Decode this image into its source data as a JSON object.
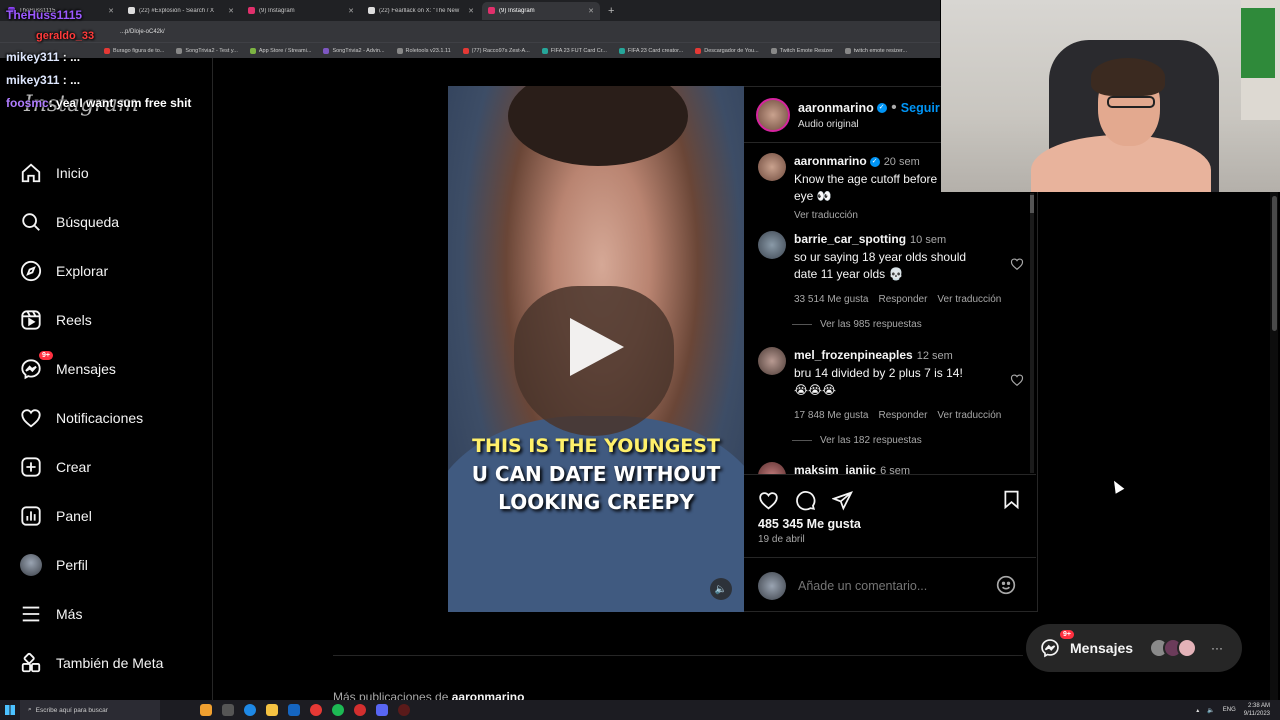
{
  "browser": {
    "tabs": [
      {
        "label": "TheHuss1115",
        "color": "#9146ff",
        "active": false
      },
      {
        "label": "(22) #Explosión - Search / X",
        "color": "#ffffff",
        "active": false
      },
      {
        "label": "(9) Instagram",
        "color": "#e1306c",
        "active": false
      },
      {
        "label": "(22) Fearllack on X: \"The New",
        "color": "#ffffff",
        "active": false
      },
      {
        "label": "(9) Instagram",
        "color": "#e1306c",
        "active": true
      }
    ],
    "url": "...p/Dloje-oC42k/",
    "bookmarks": [
      "Burago figura de to...",
      "SongTrivia2 - Test y...",
      "App Store / Streami...",
      "SongTrivia2 - Advin...",
      "Roletools v23.1.11",
      "(77) Racco97s Zest-A...",
      "FIFA 23 FUT Card Cr...",
      "FIFA 23 Card creator...",
      "Descargador de You...",
      "Twitch Emote Resizer",
      "twitch emote resizer..."
    ]
  },
  "chat": [
    {
      "user": "TheHuss1115",
      "text": ""
    },
    {
      "user": "geraldo_33",
      "text": ""
    },
    {
      "user": "mikey311",
      "text": ": ..."
    },
    {
      "user": "mikey311",
      "text": ": ..."
    },
    {
      "user": "foosmc",
      "text": ": yea I want sum free shit"
    }
  ],
  "sidebar": {
    "logo": "Instagram",
    "items": [
      {
        "label": "Inicio",
        "icon": "home-icon"
      },
      {
        "label": "Búsqueda",
        "icon": "search-icon"
      },
      {
        "label": "Explorar",
        "icon": "compass-icon"
      },
      {
        "label": "Reels",
        "icon": "reels-icon"
      },
      {
        "label": "Mensajes",
        "icon": "messenger-icon",
        "badge": "9+"
      },
      {
        "label": "Notificaciones",
        "icon": "heart-icon"
      },
      {
        "label": "Crear",
        "icon": "plus-square-icon"
      },
      {
        "label": "Panel",
        "icon": "chart-icon"
      },
      {
        "label": "Perfil",
        "icon": "avatar"
      },
      {
        "label": "Más",
        "icon": "menu-icon"
      },
      {
        "label": "También de Meta",
        "icon": "meta-apps-icon"
      }
    ]
  },
  "post": {
    "author": "aaronmarino",
    "follow_label": "Seguir",
    "audio": "Audio original",
    "video_caption": {
      "line1": "THIS IS THE YOUNGEST",
      "line2": "U CAN DATE WITHOUT",
      "line3": "LOOKING CREEPY"
    },
    "likes": "485 345 Me gusta",
    "date": "19 de abril",
    "comment_placeholder": "Añade un comentario..."
  },
  "comments": [
    {
      "user": "aaronmarino",
      "time": "20 sem",
      "text": "Know the age cutoff before",
      "text2": "eye 👀",
      "translate": "Ver traducción",
      "likes": "",
      "reply": "",
      "replies": ""
    },
    {
      "user": "barrie_car_spotting",
      "time": "10 sem",
      "text": "so ur saying 18 year olds should",
      "text2": "date 11 year olds 💀",
      "translate": "Ver traducción",
      "likes": "33 514 Me gusta",
      "reply": "Responder",
      "replies": "Ver las 985 respuestas"
    },
    {
      "user": "mel_frozenpineaples",
      "time": "12 sem",
      "text": "bru 14 divided by 2 plus 7 is 14!",
      "text2": "😭😭😭",
      "translate": "Ver traducción",
      "likes": "17 848 Me gusta",
      "reply": "Responder",
      "replies": "Ver las 182 respuestas"
    },
    {
      "user": "maksim_janjic",
      "time": "6 sem",
      "text": "",
      "text2": "",
      "translate": "",
      "likes": "",
      "reply": "",
      "replies": ""
    }
  ],
  "more_posts": {
    "prefix": "Más publicaciones de",
    "user": "aaronmarino"
  },
  "messages_pill": {
    "label": "Mensajes",
    "badge": "9+",
    "more": "···"
  },
  "taskbar": {
    "search_placeholder": "Escribe aquí para buscar",
    "lang": "ENG",
    "time": "2:38 AM",
    "date": "9/11/2023"
  },
  "colors": {
    "accent": "#0095f6",
    "badge": "#ff3040",
    "caption_yellow": "#fff06a"
  }
}
